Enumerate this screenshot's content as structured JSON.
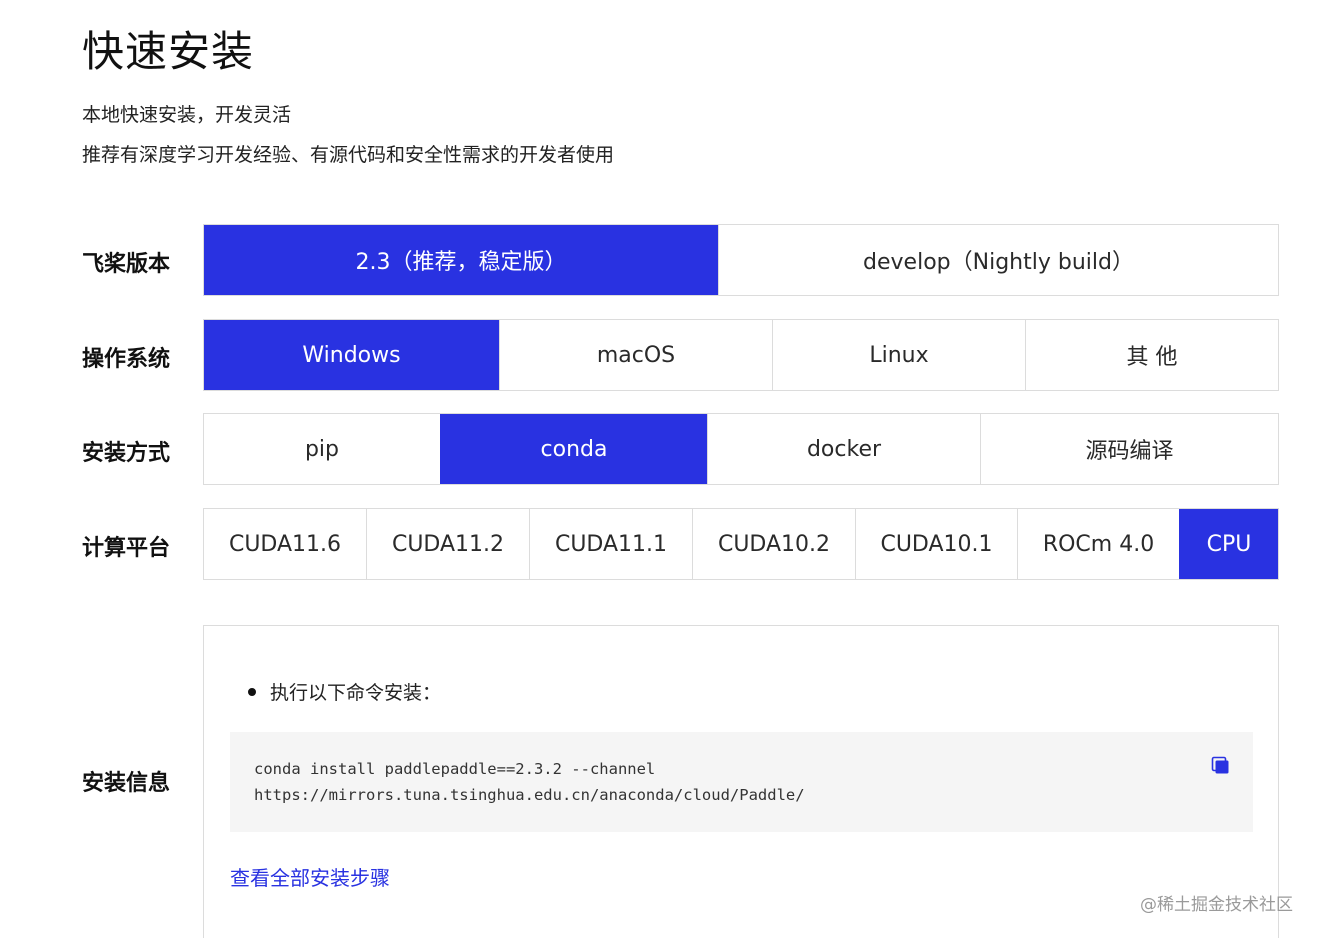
{
  "header": {
    "title": "快速安装",
    "subtitle_line1": "本地快速安装，开发灵活",
    "subtitle_line2": "推荐有深度学习开发经验、有源代码和安全性需求的开发者使用"
  },
  "rows": {
    "version": {
      "label": "飞桨版本",
      "options": [
        "2.3（推荐，稳定版）",
        "develop（Nightly build）"
      ],
      "selected": "2.3（推荐，稳定版）"
    },
    "os": {
      "label": "操作系统",
      "options": [
        "Windows",
        "macOS",
        "Linux",
        "其 他"
      ],
      "selected": "Windows"
    },
    "install_method": {
      "label": "安装方式",
      "options": [
        "pip",
        "conda",
        "docker",
        "源码编译"
      ],
      "selected": "conda"
    },
    "compute_platform": {
      "label": "计算平台",
      "options": [
        "CUDA11.6",
        "CUDA11.2",
        "CUDA11.1",
        "CUDA10.2",
        "CUDA10.1",
        "ROCm 4.0",
        "CPU"
      ],
      "selected": "CPU"
    }
  },
  "install_info": {
    "label": "安装信息",
    "instruction": "执行以下命令安装：",
    "command_line1": "conda install paddlepaddle==2.3.2 --channel",
    "command_line2": "https://mirrors.tuna.tsinghua.edu.cn/anaconda/cloud/Paddle/",
    "copy_icon": "copy-icon",
    "view_all_link": "查看全部安装步骤"
  },
  "watermark": "@稀土掘金技术社区",
  "colors": {
    "accent": "#2932e1",
    "border": "#dcdcdc",
    "code_bg": "#f5f5f5"
  }
}
